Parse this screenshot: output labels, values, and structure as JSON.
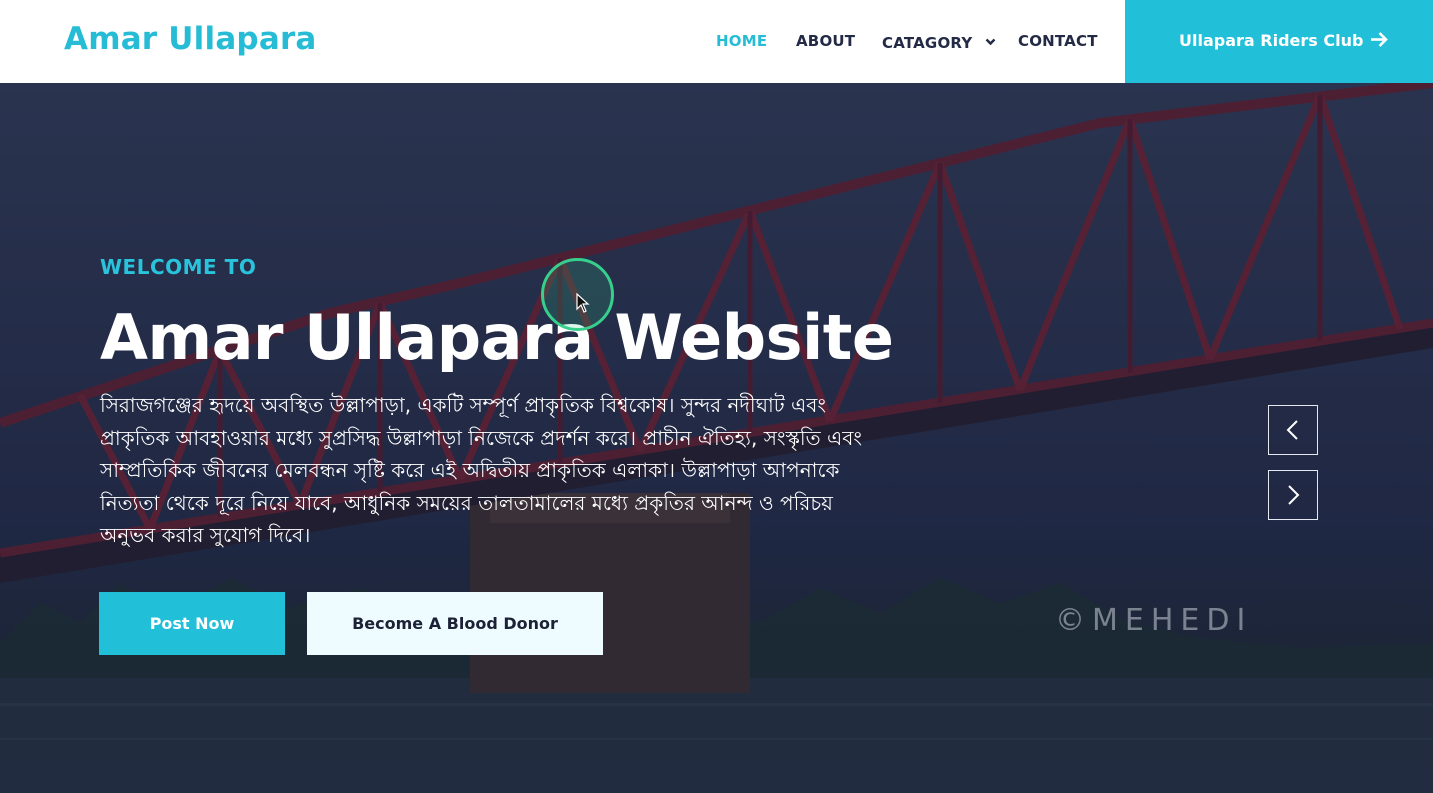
{
  "header": {
    "logo": "Amar Ullapara",
    "nav": [
      {
        "label": "HOME",
        "active": true
      },
      {
        "label": "ABOUT",
        "active": false
      },
      {
        "label": "CATAGORY",
        "active": false
      },
      {
        "label": "CONTACT",
        "active": false
      }
    ],
    "cta_label": "Ullapara Riders Club",
    "cta_icon": "arrow-right-icon"
  },
  "hero": {
    "eyebrow": "WELCOME TO",
    "title": "Amar Ullapara Website",
    "description": "সিরাজগঞ্জের হৃদয়ে অবস্থিত উল্লাপাড়া, একটি সম্পূর্ণ প্রাকৃতিক বিশ্বকোষ। সুন্দর নদীঘাট এবং প্রাকৃতিক আবহাওয়ার মধ্যে সুপ্রসিদ্ধ উল্লাপাড়া নিজেকে প্রদর্শন করে। প্রাচীন ঐতিহ্য, সংস্কৃতি এবং সাম্প্রতিকিক জীবনের মেলবন্ধন সৃষ্টি করে এই অদ্বিতীয় প্রাকৃতিক এলাকা। উল্লাপাড়া আপনাকে নিত্যতা থেকে দূরে নিয়ে যাবে, আধুনিক সময়ের তালতামালের মধ্যে প্রকৃতির আনন্দ ও পরিচয় অনুভব করার সুযোগ দিবে।",
    "primary_button": "Post Now",
    "secondary_button": "Become A Blood Donor",
    "watermark": "©MEHEDI"
  },
  "slider": {
    "prev_icon": "chevron-left-icon",
    "next_icon": "chevron-right-icon"
  },
  "colors": {
    "accent": "#22c0d8",
    "nav_text": "#232a45",
    "cursor_highlight": "#37cf8c"
  }
}
